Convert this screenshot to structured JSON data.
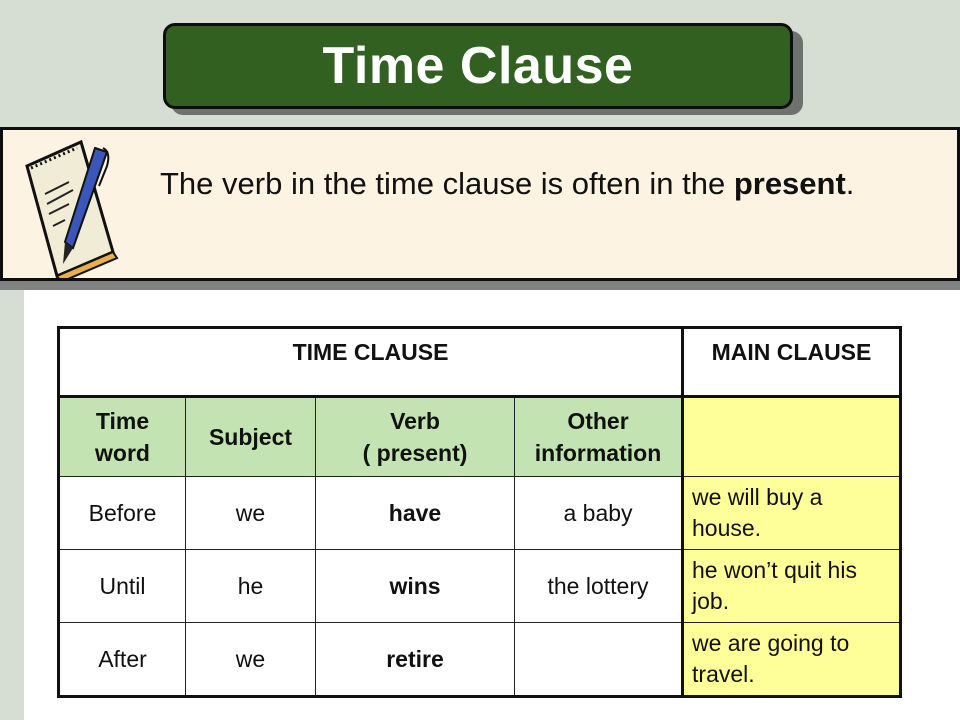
{
  "slide": {
    "title": "Time Clause",
    "note": {
      "text_before": "The verb in the time clause is often in the ",
      "text_bold": "present",
      "text_after": ".",
      "icon": "notepad-pen-icon"
    }
  },
  "table": {
    "group_headers": {
      "time_clause": "TIME CLAUSE",
      "main_clause": "MAIN CLAUSE"
    },
    "column_headers": [
      {
        "line1": "Time",
        "line2": "word"
      },
      {
        "line1": "Subject",
        "line2": ""
      },
      {
        "line1": "Verb",
        "line2": "( present)"
      },
      {
        "line1": "Other",
        "line2": "information"
      },
      {
        "line1": "",
        "line2": ""
      }
    ],
    "rows": [
      {
        "time_word": "Before",
        "subject": "we",
        "verb": "have",
        "other": "a baby",
        "main": "we will buy a house."
      },
      {
        "time_word": "Until",
        "subject": "he",
        "verb": "wins",
        "other": "the lottery",
        "main": "he won’t quit his job."
      },
      {
        "time_word": "After",
        "subject": "we",
        "verb": "retire",
        "other": "",
        "main": "we are going to travel."
      }
    ]
  },
  "colors": {
    "title_bg": "#316021",
    "note_bg": "#fcf3e2",
    "header_green": "#c3e3b2",
    "main_clause_yellow": "#ffff99",
    "background": "#d6ddd3"
  }
}
